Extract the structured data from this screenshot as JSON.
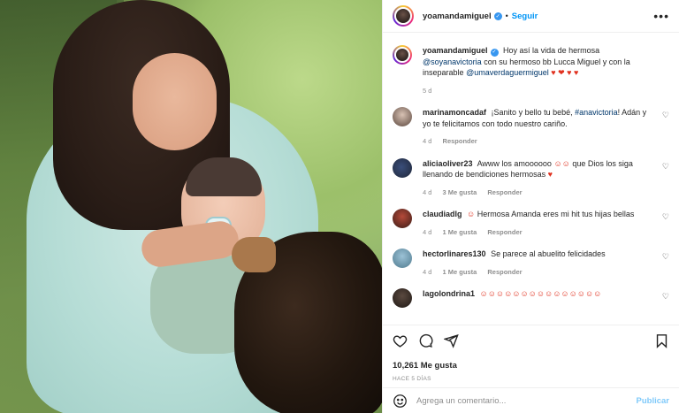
{
  "post": {
    "username": "yoamandamiguel",
    "follow_label": "Seguir",
    "more_label": "•••"
  },
  "comments": [
    {
      "user": "yoamandamiguel",
      "text_1": "Hoy así la vida de hermosa",
      "mention_1": "@soyanavictoria",
      "text_2": "con su hermoso bb Lucca Miguel y con la inseparable",
      "mention_2": "@umaverdaguermiguel",
      "emojis": "♥ ❤ ♥ ♥",
      "age": "5 d"
    },
    {
      "user": "marinamoncadaf",
      "text_1": "¡Sanito y bello tu bebé,",
      "hashtag": "#anavictoria",
      "text_2": "! Adán y yo te felicitamos con todo nuestro cariño.",
      "age": "4 d",
      "reply": "Responder"
    },
    {
      "user": "aliciaoliver23",
      "text_1": "Awww los amoooooo",
      "emoji_a": "☺☺",
      "text_2": "que Dios los siga llenando de bendiciones hermosas",
      "emoji_b": "♥",
      "age": "4 d",
      "likes": "3 Me gusta",
      "reply": "Responder"
    },
    {
      "user": "claudiadlg",
      "emoji_a": "☺",
      "text_1": "Hermosa Amanda eres mi hit tus hijas bellas",
      "age": "4 d",
      "likes": "1 Me gusta",
      "reply": "Responder"
    },
    {
      "user": "hectorlinares130",
      "text_1": "Se parece al abuelito felicidades",
      "age": "4 d",
      "likes": "1 Me gusta",
      "reply": "Responder"
    },
    {
      "user": "lagolondrina1",
      "emojis": "☺☺☺☺☺☺☺☺☺☺☺☺☺☺☺"
    }
  ],
  "stats": {
    "likes": "10,261 Me gusta",
    "time": "HACE 5 DÍAS"
  },
  "add_comment": {
    "placeholder": "Agrega un comentario...",
    "publish": "Publicar"
  },
  "colors": {
    "accent": "#0095f6",
    "verified": "#3897f0",
    "muted": "#8e8e8e"
  }
}
